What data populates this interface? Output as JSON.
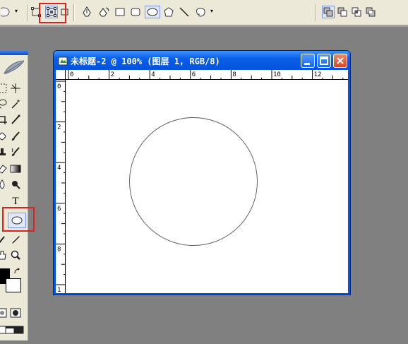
{
  "options_bar": {
    "tools": [
      "shape-layers-icon",
      "paths-icon",
      "fill-pixels-icon",
      "pen-icon",
      "freeform-pen-icon",
      "rectangle-icon",
      "rounded-rectangle-icon",
      "ellipse-icon",
      "polygon-icon",
      "line-icon",
      "custom-shape-icon"
    ],
    "combine_modes": [
      "add-to-shape-icon",
      "subtract-from-shape-icon",
      "intersect-shape-icon",
      "exclude-overlap-icon"
    ]
  },
  "document": {
    "title": "未标题-2 @ 100% (图层 1, RGB/8)",
    "ruler_h_labels": [
      "0",
      "2",
      "4",
      "6",
      "8",
      "10",
      "12"
    ],
    "ruler_v_labels": [
      "0",
      "2",
      "4",
      "6",
      "8",
      "1"
    ]
  },
  "toolbox": {
    "text_tool": "T",
    "selected_tool": "ellipse-tool"
  },
  "colors": {
    "foreground": "#000000",
    "background": "#ffffff",
    "highlight": "#e02020",
    "workspace": "#808080"
  }
}
